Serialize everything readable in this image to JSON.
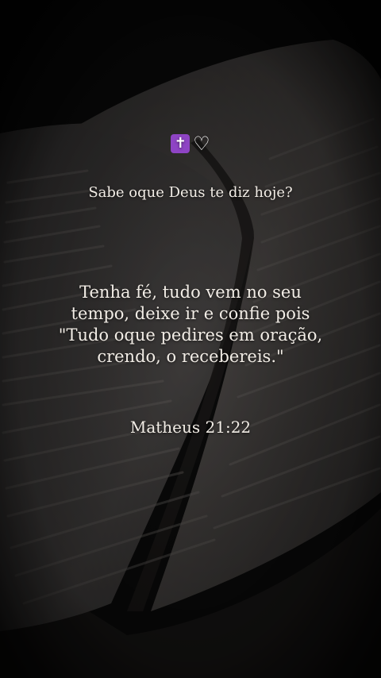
{
  "icons": {
    "cross": "latin-cross-icon",
    "heart": "white-heart-icon"
  },
  "text": {
    "question": "Sabe oque Deus te diz hoje?",
    "message_lines": [
      "Tenha fé, tudo vem no seu",
      "tempo, deixe ir e confie pois",
      "\"Tudo oque pedires em oração,",
      "crendo, o recebereis.\""
    ],
    "reference": "Matheus 21:22"
  },
  "colors": {
    "background": "#0c0c0c",
    "text": "#f2ede6",
    "cross_badge": "#8e44c4"
  }
}
